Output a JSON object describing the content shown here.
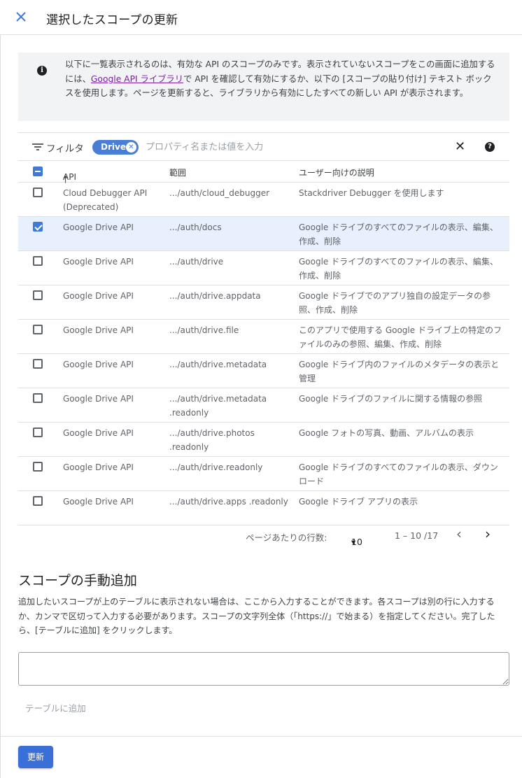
{
  "header": {
    "title": "選択したスコープの更新"
  },
  "info": {
    "text_before": "以下に一覧表示されるのは、有効な API のスコープのみです。表示されていないスコープをこの画面に追加するには、",
    "link": "Google API ライブラリ",
    "text_after": "で API を確認して有効にするか、以下の [スコープの貼り付け] テキスト ボックスを使用します。ページを更新すると、ライブラリから有効にしたすべての新しい API が表示されます。"
  },
  "filter": {
    "label": "フィルタ",
    "chip": "Drive",
    "placeholder": "プロパティ名または値を入力"
  },
  "table": {
    "headers": {
      "api": "API",
      "scope": "範囲",
      "desc": "ユーザー向けの説明"
    },
    "rows": [
      {
        "api": "Cloud Debugger API (Deprecated)",
        "scope": ".../auth/cloud_debugger",
        "desc": "Stackdriver Debugger を使用します"
      },
      {
        "api": "Google Drive API",
        "scope": ".../auth/docs",
        "desc": "Google ドライブのすべてのファイルの表示、編集、作成、削除"
      },
      {
        "api": "Google Drive API",
        "scope": ".../auth/drive",
        "desc": "Google ドライブのすべてのファイルの表示、編集、作成、削除"
      },
      {
        "api": "Google Drive API",
        "scope": ".../auth/drive.appdata",
        "desc": "Google ドライブでのアプリ独自の設定データの参照、作成、削除"
      },
      {
        "api": "Google Drive API",
        "scope": ".../auth/drive.file",
        "desc": "このアプリで使用する Google ドライブ上の特定のファイルのみの参照、編集、作成、削除"
      },
      {
        "api": "Google Drive API",
        "scope": ".../auth/drive.metadata",
        "desc": "Google ドライブ内のファイルのメタデータの表示と管理"
      },
      {
        "api": "Google Drive API",
        "scope": ".../auth/drive.metadata .readonly",
        "desc": "Google ドライブのファイルに関する情報の参照"
      },
      {
        "api": "Google Drive API",
        "scope": ".../auth/drive.photos .readonly",
        "desc": "Google フォトの写真、動画、アルバムの表示"
      },
      {
        "api": "Google Drive API",
        "scope": ".../auth/drive.readonly",
        "desc": "Google ドライブのすべてのファイルの表示、ダウンロード"
      },
      {
        "api": "Google Drive API",
        "scope": ".../auth/drive.apps .readonly",
        "desc": "Google ドライブ アプリの表示"
      }
    ],
    "checked": [
      false,
      true,
      false,
      false,
      false,
      false,
      false,
      false,
      false,
      false
    ]
  },
  "pager": {
    "rows_label": "ページあたりの行数:",
    "rows_value": "10",
    "range": "1 – 10 /17"
  },
  "manual": {
    "title": "スコープの手動追加",
    "desc": "追加したいスコープが上のテーブルに表示されない場合は、ここから入力することができます。各スコープは別の行に入力するか、カンマで区切って入力する必要があります。スコープの文字列全体（「https://」で始まる）を指定してください。完了したら、[テーブルに追加] をクリックします。",
    "add_label": "テーブルに追加"
  },
  "footer": {
    "update_label": "更新"
  },
  "colors": {
    "accent": "#3a6fd8",
    "chip": "#4a7ed6",
    "selected_row": "#e8f0fe"
  }
}
